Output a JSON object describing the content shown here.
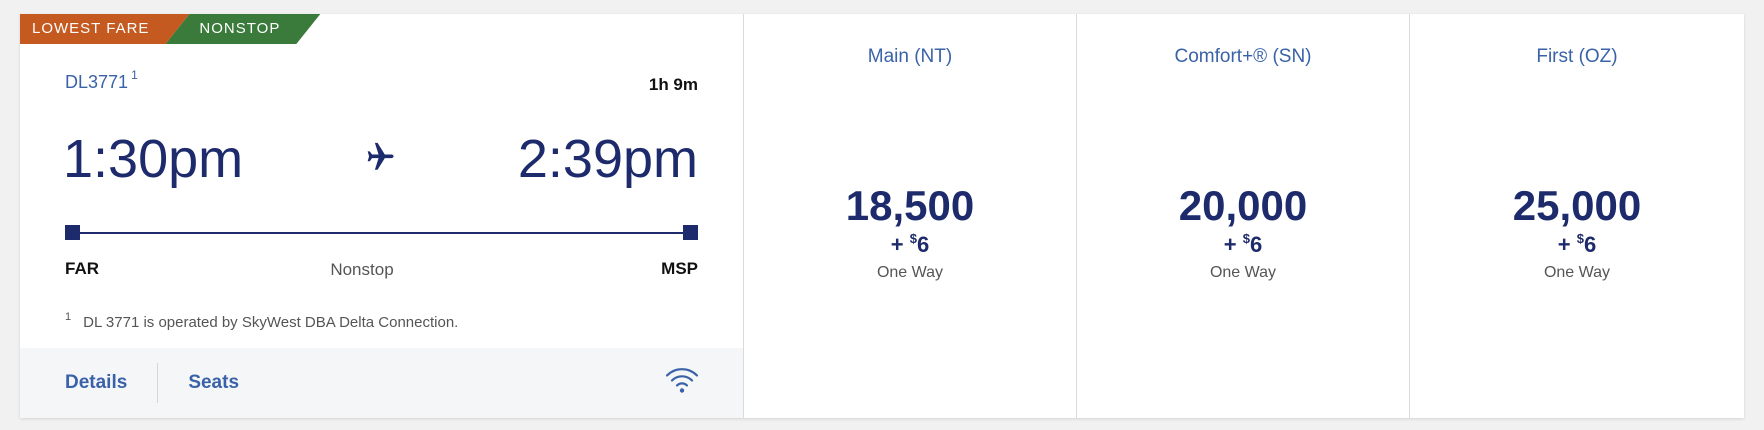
{
  "badges": {
    "lowest_fare": "LOWEST FARE",
    "nonstop": "NONSTOP"
  },
  "flight": {
    "number": "DL3771",
    "footnote_ref": "1",
    "duration": "1h 9m",
    "departure_time": "1:30pm",
    "arrival_time": "2:39pm",
    "origin": "FAR",
    "destination": "MSP",
    "stops": "Nonstop",
    "footnote_mark": "1",
    "footnote_text": "DL 3771 is operated by SkyWest DBA Delta Connection."
  },
  "actions": {
    "details": "Details",
    "seats": "Seats"
  },
  "icons": {
    "plane": "airplane-icon",
    "wifi": "wifi-icon"
  },
  "fares": [
    {
      "title": "Main (NT)",
      "miles": "18,500",
      "plus": "+",
      "currency": "$",
      "tax": "6",
      "type": "One Way"
    },
    {
      "title": "Comfort+® (SN)",
      "miles": "20,000",
      "plus": "+",
      "currency": "$",
      "tax": "6",
      "type": "One Way"
    },
    {
      "title": "First (OZ)",
      "miles": "25,000",
      "plus": "+",
      "currency": "$",
      "tax": "6",
      "type": "One Way"
    }
  ],
  "colors": {
    "brand_navy": "#1d2a6b",
    "link_blue": "#3a62a8",
    "badge_orange": "#c45a20",
    "badge_green": "#3a7a3a"
  }
}
